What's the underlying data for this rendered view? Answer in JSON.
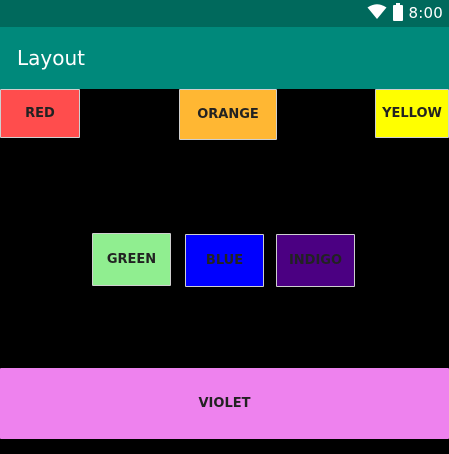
{
  "status_bar": {
    "time": "8:00",
    "icons": [
      "wifi-icon",
      "battery-icon"
    ],
    "background_color": "#00695c"
  },
  "app_bar": {
    "title": "Layout",
    "background_color": "#00897b"
  },
  "buttons": {
    "red": {
      "label": "RED",
      "color": "#ff4d4d"
    },
    "orange": {
      "label": "ORANGE",
      "color": "#ffb733"
    },
    "yellow": {
      "label": "YELLOW",
      "color": "#ffff00"
    },
    "green": {
      "label": "GREEN",
      "color": "#90ee90"
    },
    "blue": {
      "label": "BLUE",
      "color": "#0000ff"
    },
    "indigo": {
      "label": "INDIGO",
      "color": "#4b0082"
    },
    "violet": {
      "label": "VIOLET",
      "color": "#ee82ee"
    }
  },
  "canvas_background": "#000000"
}
